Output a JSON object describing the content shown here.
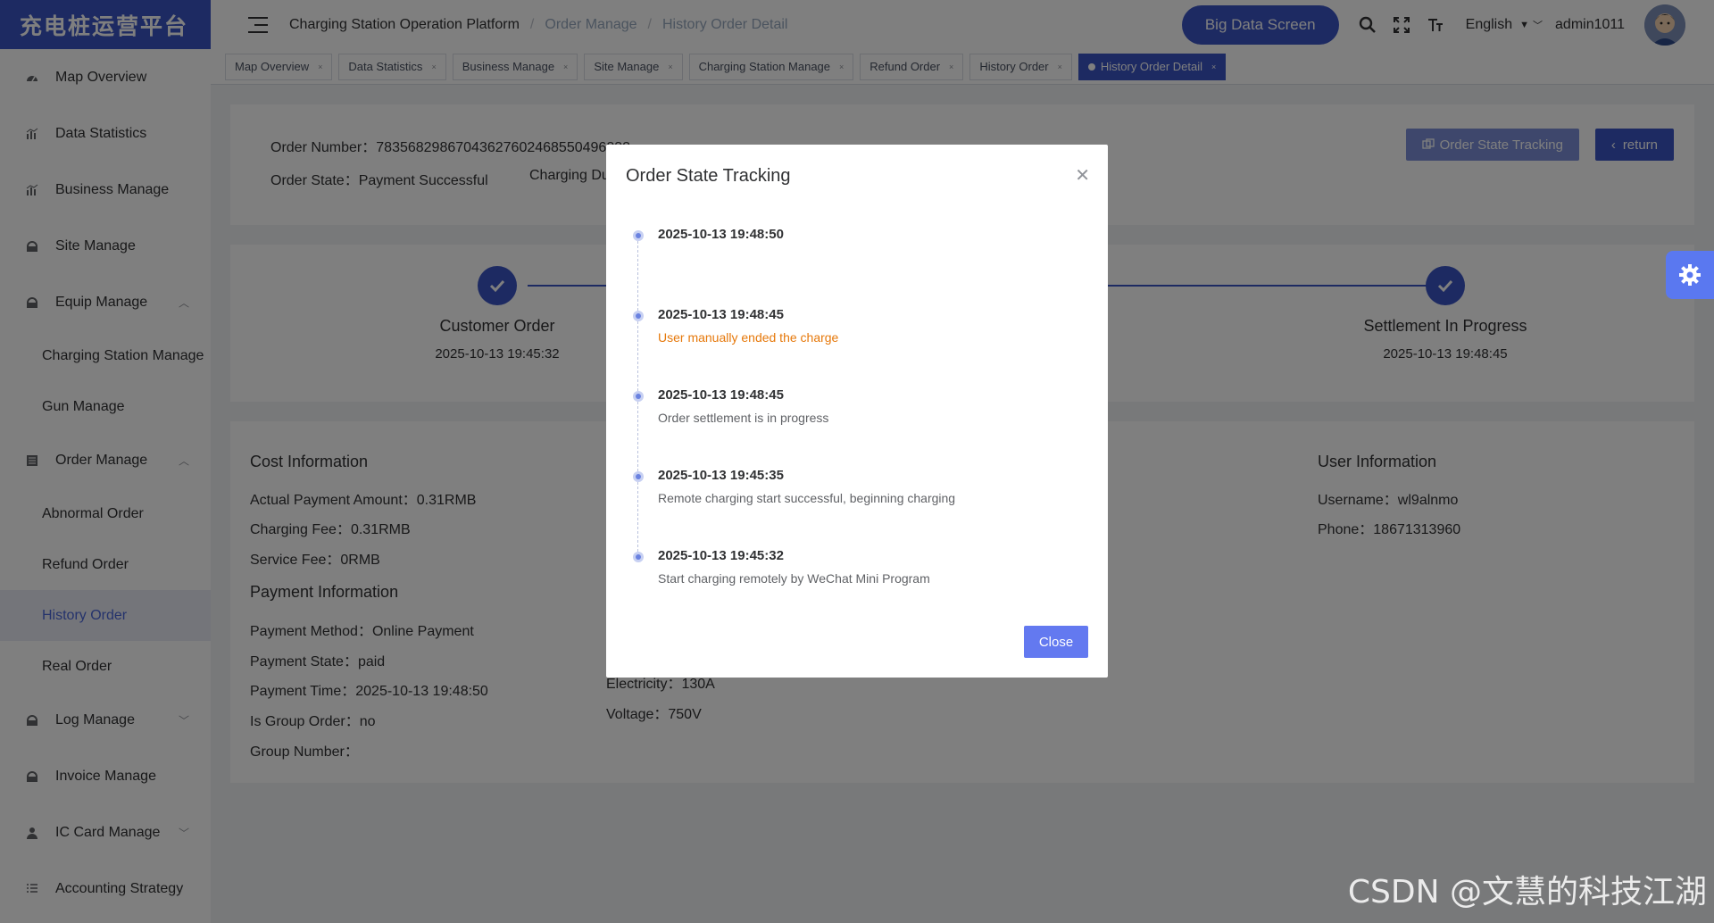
{
  "app": {
    "logo_text": "充电桩运营平台"
  },
  "sidebar": {
    "items": [
      {
        "label": "Map Overview",
        "icon": "dashboard-icon"
      },
      {
        "label": "Data Statistics",
        "icon": "chart-icon"
      },
      {
        "label": "Business Manage",
        "icon": "chart-icon"
      },
      {
        "label": "Site Manage",
        "icon": "site-icon"
      },
      {
        "label": "Equip Manage",
        "icon": "equip-icon",
        "expanded": true
      },
      {
        "label": "Charging Station Manage",
        "sub": true
      },
      {
        "label": "Gun Manage",
        "sub": true
      },
      {
        "label": "Order Manage",
        "icon": "order-icon",
        "expanded": true
      },
      {
        "label": "Abnormal Order",
        "sub": true
      },
      {
        "label": "Refund Order",
        "sub": true
      },
      {
        "label": "History Order",
        "sub": true,
        "active": true
      },
      {
        "label": "Real Order",
        "sub": true
      },
      {
        "label": "Log Manage",
        "icon": "log-icon",
        "expanded": false
      },
      {
        "label": "Invoice Manage",
        "icon": "invoice-icon"
      },
      {
        "label": "IC Card Manage",
        "icon": "user-icon",
        "expanded": false
      },
      {
        "label": "Accounting Strategy",
        "icon": "list-icon"
      }
    ]
  },
  "header": {
    "breadcrumb": [
      "Charging Station Operation Platform",
      "Order Manage",
      "History Order Detail"
    ],
    "big_data_label": "Big Data Screen",
    "language": "English",
    "username": "admin1011"
  },
  "tags": [
    {
      "label": "Map Overview"
    },
    {
      "label": "Data Statistics"
    },
    {
      "label": "Business Manage"
    },
    {
      "label": "Site Manage"
    },
    {
      "label": "Charging Station Manage"
    },
    {
      "label": "Refund Order"
    },
    {
      "label": "History Order"
    },
    {
      "label": "History Order Detail",
      "active": true
    }
  ],
  "order": {
    "number_label": "Order Number：",
    "number_value": "78356829867043627602468550496232",
    "state_label": "Order State：",
    "state_value": "Payment Successful",
    "charging_du_label": "Charging Du",
    "track_button": "Order State Tracking",
    "return_button": "return"
  },
  "steps": [
    {
      "title": "Customer Order",
      "time": "2025-10-13 19:45:32"
    },
    {
      "title": "Settlement In Progress",
      "time": "2025-10-13 19:48:45"
    }
  ],
  "cost": {
    "title": "Cost Information",
    "actual_payment": "Actual Payment Amount：0.31RMB",
    "charging_fee": "Charging Fee：0.31RMB",
    "service_fee": "Service Fee：0RMB"
  },
  "payment": {
    "title": "Payment Information",
    "method": "Payment Method：Online Payment",
    "state": "Payment State：paid",
    "time": "Payment Time：2025-10-13 19:48:50",
    "group_order": "Is Group Order：no",
    "group_number": "Group Number："
  },
  "device": {
    "electricity": "Electricity：130A",
    "voltage": "Voltage：750V"
  },
  "user": {
    "title": "User Information",
    "username": "Username：wl9alnmo",
    "phone": "Phone：18671313960"
  },
  "modal": {
    "title": "Order State Tracking",
    "close_label": "Close",
    "events": [
      {
        "time": "2025-10-13 19:48:50",
        "desc": "",
        "warn": false
      },
      {
        "time": "2025-10-13 19:48:45",
        "desc": "User manually ended the charge",
        "warn": true
      },
      {
        "time": "2025-10-13 19:48:45",
        "desc": "Order settlement is in progress",
        "warn": false
      },
      {
        "time": "2025-10-13 19:45:35",
        "desc": "Remote charging start successful, beginning charging",
        "warn": false
      },
      {
        "time": "2025-10-13 19:45:32",
        "desc": "Start charging remotely by WeChat Mini Program",
        "warn": false
      }
    ]
  },
  "watermark": "CSDN @文慧的科技江湖",
  "colors": {
    "primary": "#3a54c4",
    "warn": "#e6780a"
  }
}
